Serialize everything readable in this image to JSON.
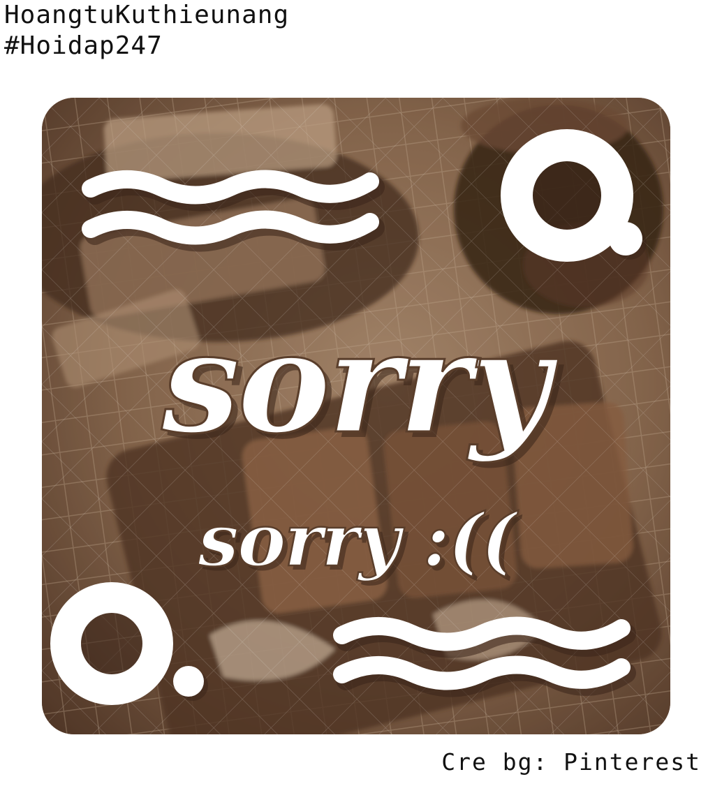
{
  "header": {
    "author": "HoangtuKuthieunang",
    "hashtag": "#Hoidap247"
  },
  "artwork": {
    "main_word": "sorry",
    "sub_text": "sorry :((",
    "colors": {
      "text": "#ffffff",
      "outline": "#5a3e2b",
      "background_dark": "#4a3122",
      "background_mid": "#8a6b52",
      "background_light": "#c2a88e"
    }
  },
  "footer": {
    "credit": "Cre bg: Pinterest"
  }
}
